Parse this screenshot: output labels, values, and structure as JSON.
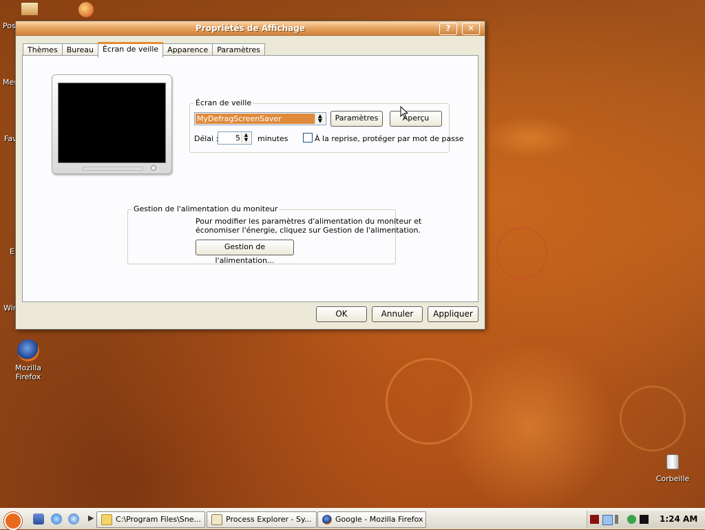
{
  "desktop": {
    "icons": [
      {
        "label": "Mozilla Firefox"
      },
      {
        "label": "Corbeille"
      }
    ],
    "partial_labels": [
      "Pos",
      "Mes",
      "Fav",
      "E",
      "Win"
    ]
  },
  "dialog": {
    "title": "Propriétés de Affichage",
    "tabs": [
      "Thèmes",
      "Bureau",
      "Écran de veille",
      "Apparence",
      "Paramètres"
    ],
    "active_tab": "Écran de veille",
    "screensaver": {
      "legend": "Écran de veille",
      "selected": "MyDefragScreenSaver",
      "settings_button": "Paramètres",
      "preview_button": "Aperçu",
      "delay_label": "Délai :",
      "delay_value": "5",
      "delay_unit": "minutes",
      "password_label": "À la reprise, protéger par mot de passe",
      "password_checked": false
    },
    "power": {
      "legend": "Gestion de l'alimentation du moniteur",
      "description_line1": "Pour modifier les paramètres d'alimentation du moniteur et",
      "description_line2": "économiser l'énergie, cliquez sur Gestion de l'alimentation.",
      "button": "Gestion de l'alimentation..."
    },
    "buttons": {
      "ok": "OK",
      "cancel": "Annuler",
      "apply": "Appliquer"
    },
    "title_help": "?",
    "title_close": "✕"
  },
  "taskbar": {
    "tasks": [
      {
        "label": "C:\\Program Files\\Sne..."
      },
      {
        "label": "Process Explorer - Sy..."
      },
      {
        "label": "Google - Mozilla Firefox"
      }
    ],
    "clock": "1:24 AM",
    "colors": {
      "accent": "#e68b2c",
      "selection": "#e08a3c",
      "start": "#e86a1c"
    }
  }
}
